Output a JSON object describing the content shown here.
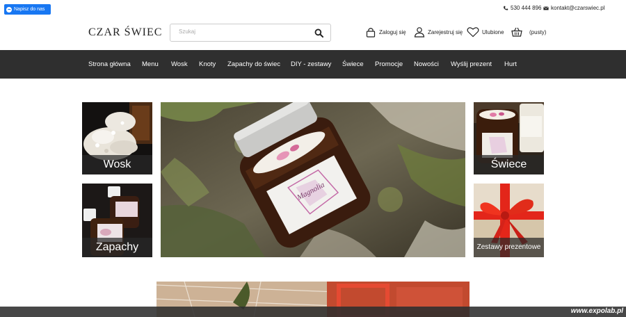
{
  "messenger": {
    "label": "Napisz do nas"
  },
  "contact": {
    "phone": "530 444 896",
    "email": "kontakt@czarswiec.pl"
  },
  "header": {
    "logo": "CZAR ŚWIEC",
    "search_placeholder": "Szukaj",
    "login": "Zaloguj się",
    "register": "Zarejestruj się",
    "favorites": "Ulubione",
    "cart": "(pusty)"
  },
  "nav": [
    "Strona główna",
    "Menu",
    "Wosk",
    "Knoty",
    "Zapachy do świec",
    "DIY - zestawy",
    "Świece",
    "Promocje",
    "Nowości",
    "Wyślij prezent",
    "Hurt"
  ],
  "tiles": {
    "wosk": "Wosk",
    "zapachy": "Zapachy",
    "swiece": "Świece",
    "zestawy": "Zestawy prezentowe"
  },
  "hero": {
    "jar_label": "Magnolia"
  },
  "watermark": "www.expolab.pl",
  "colors": {
    "nav_bg": "#2f2f2f",
    "messenger": "#1877f2"
  }
}
